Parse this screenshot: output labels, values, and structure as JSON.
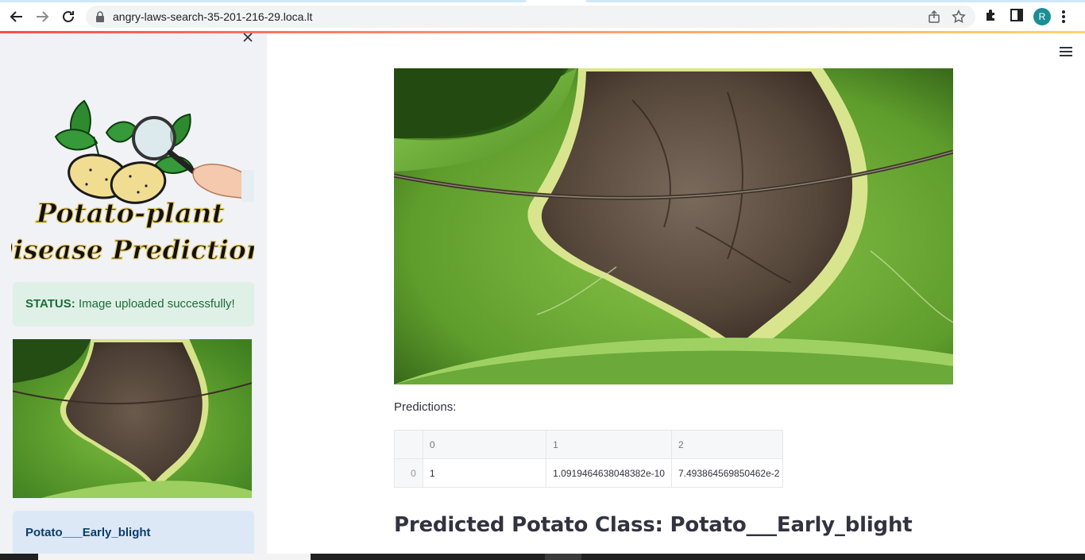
{
  "browser": {
    "url": "angry-laws-search-35-201-216-29.loca.lt",
    "profile_initial": "R"
  },
  "sidebar": {
    "logo_line1": "Potato-plant",
    "logo_line2": "Disease Prediction",
    "status_label": "STATUS:",
    "status_text": " Image uploaded successfully!",
    "predicted_class": "Potato___Early_blight"
  },
  "main": {
    "predictions_label": "Predictions:",
    "table": {
      "columns": [
        "0",
        "1",
        "2"
      ],
      "rows": [
        {
          "index": "0",
          "values": [
            "1",
            "1.0919464638048382e-10",
            "7.493864569850462e-2"
          ]
        }
      ]
    },
    "predicted_heading": "Predicted Potato Class: Potato___Early_blight"
  },
  "colors": {
    "accent": "#ff4b4b",
    "success_bg": "#dff0e6",
    "info_bg": "#dce8f6",
    "sidebar_bg": "#f0f2f6"
  }
}
